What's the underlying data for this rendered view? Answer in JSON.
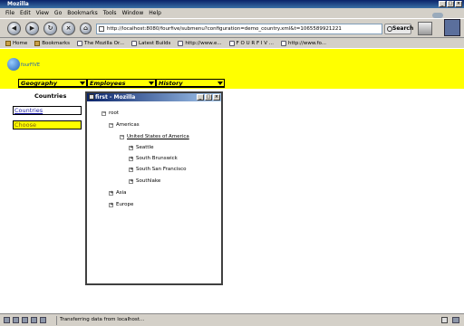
{
  "window": {
    "title": "Mozilla"
  },
  "menu": [
    "File",
    "Edit",
    "View",
    "Go",
    "Bookmarks",
    "Tools",
    "Window",
    "Help"
  ],
  "nav": {
    "url": "http://localhost:8080/fourfive/submenu?configuration=demo_country.xml&t=1065589921221",
    "search_label": "Search"
  },
  "bookmarks": [
    "Home",
    "Bookmarks",
    "The Mozilla Or...",
    "Latest Builds",
    "http://www.e...",
    "F O U R F I V ...",
    "http://www.fo..."
  ],
  "header": {
    "logo_text": "fourFIVE",
    "tabs": [
      "Geography",
      "Employees",
      "History"
    ]
  },
  "sidebar": {
    "heading": "Countries",
    "countries_button": "Countries",
    "choose_button": "Choose"
  },
  "popup": {
    "title": "first - Mozilla",
    "tree": {
      "root": "root",
      "americas": "Americas",
      "usa": "United States of America",
      "cities": [
        "Seattle",
        "South Brunswick",
        "South San Francisco",
        "Southlake"
      ],
      "asia": "Asia",
      "europe": "Europe"
    }
  },
  "status": {
    "text": "Transferring data from localhost..."
  }
}
